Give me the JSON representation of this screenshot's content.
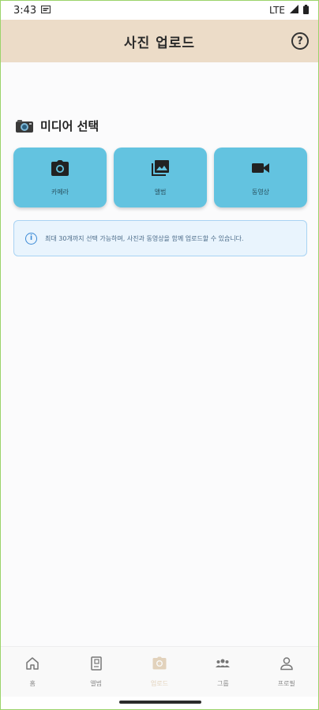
{
  "status_bar": {
    "time": "3:43",
    "network": "LTE"
  },
  "app_bar": {
    "title": "사진 업로드",
    "help_icon": "question-circle-icon"
  },
  "section": {
    "emoji_icon": "camera-emoji-icon",
    "title": "미디어 선택"
  },
  "media_buttons": [
    {
      "icon": "camera-icon",
      "label": "카메라"
    },
    {
      "icon": "gallery-icon",
      "label": "앨범"
    },
    {
      "icon": "video-camera-icon",
      "label": "동영상"
    }
  ],
  "info": {
    "icon": "info-icon",
    "text": "최대 30개까지 선택 가능하며, 사진과 동영상을 함께 업로드할 수 있습니다."
  },
  "bottom_nav": {
    "active_index": 2,
    "items": [
      {
        "icon": "home-icon",
        "label": "홈"
      },
      {
        "icon": "book-icon",
        "label": "앨범"
      },
      {
        "icon": "camera-icon",
        "label": "업로드"
      },
      {
        "icon": "group-icon",
        "label": "그룹"
      },
      {
        "icon": "person-icon",
        "label": "프로필"
      }
    ]
  },
  "colors": {
    "app_bar": "#ecdcc8",
    "media_button": "#63c3e0",
    "info_border": "#a9d3f3",
    "info_background": "#e9f4fd",
    "nav_active": "#e2d2bc"
  }
}
